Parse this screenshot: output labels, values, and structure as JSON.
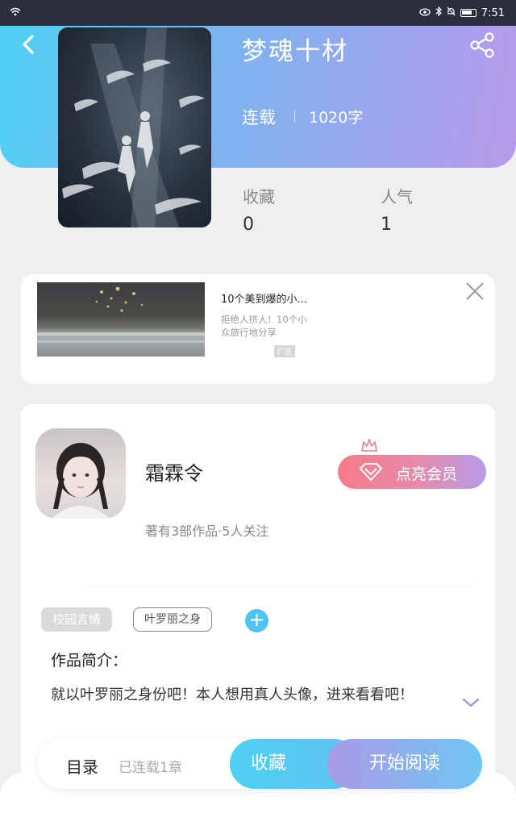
{
  "status_bar": {
    "time": "7:51"
  },
  "book": {
    "title": "梦魂十材",
    "status": "连载",
    "word_count": "1020字",
    "stats": [
      {
        "label": "收藏",
        "value": "0"
      },
      {
        "label": "人气",
        "value": "1"
      }
    ]
  },
  "ad": {
    "title": "10个美到爆的小...",
    "description": "拒绝人挤人！10个小众旅行地分享",
    "tag": "广告"
  },
  "author": {
    "name": "霜霖令",
    "vip_label": "点亮会员",
    "meta": "著有3部作品·5人关注"
  },
  "tags": [
    "校园言情",
    "叶罗丽之身"
  ],
  "intro": {
    "heading": "作品简介：",
    "text": "就以叶罗丽之身份吧！本人想用真人头像，进来看看吧！"
  },
  "bottom_bar": {
    "toc_label": "目录",
    "chapters": "已连载1章",
    "favorite_label": "收藏",
    "read_label": "开始阅读"
  },
  "colors": {
    "accent_cyan": "#4fd0f2",
    "accent_purple": "#b79aec",
    "vip_pink": "#f57b88"
  }
}
